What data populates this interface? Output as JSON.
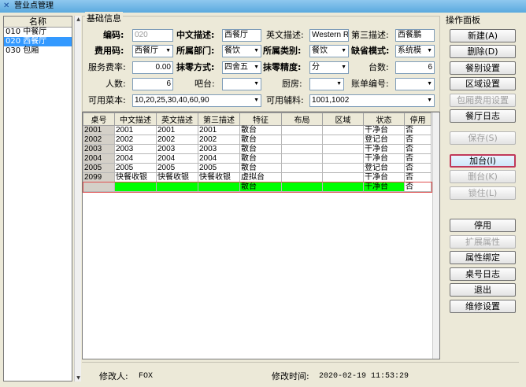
{
  "window": {
    "title": "营业点管理",
    "icon": "app-icon"
  },
  "left_list": {
    "header": "名称",
    "items": [
      "010 中餐厅",
      "020 西餐厅",
      "030 包厢"
    ],
    "selected_index": 1
  },
  "basic_info": {
    "title": "基础信息",
    "code_label": "编码:",
    "code_value": "020",
    "cn_desc_label": "中文描述:",
    "cn_desc_value": "西餐厅",
    "en_desc_label": "英文描述:",
    "en_desc_value": "Western R",
    "third_desc_label": "第三描述:",
    "third_desc_value": "西餐鵬",
    "fee_code_label": "费用码:",
    "fee_code_value": "西餐厅",
    "dept_label": "所属部门:",
    "dept_value": "餐饮",
    "category_label": "所属类别:",
    "category_value": "餐饮",
    "default_mode_label": "缺省模式:",
    "default_mode_value": "系统模",
    "service_rate_label": "服务费率:",
    "service_rate_value": "0.00",
    "rounding_mode_label": "抹零方式:",
    "rounding_mode_value": "四舍五",
    "rounding_precision_label": "抹零精度:",
    "rounding_precision_value": "分",
    "tables_label": "台数:",
    "tables_value": "6",
    "people_label": "人数:",
    "people_value": "6",
    "bar_label": "吧台:",
    "bar_value": "",
    "kitchen_label": "厨房:",
    "kitchen_value": "",
    "bill_no_label": "账单编号:",
    "bill_no_value": "",
    "menu_label": "可用菜本:",
    "menu_value": "10,20,25,30,40,60,90",
    "aux_label": "可用辅料:",
    "aux_value": "1001,1002"
  },
  "grid": {
    "columns": [
      "桌号",
      "中文描述",
      "英文描述",
      "第三描述",
      "特征",
      "布局",
      "区域",
      "状态",
      "停用"
    ],
    "rows": [
      [
        "2001",
        "2001",
        "2001",
        "2001",
        "散台",
        "",
        "",
        "干净台",
        "否"
      ],
      [
        "2002",
        "2002",
        "2002",
        "2002",
        "散台",
        "",
        "",
        "登记台",
        "否"
      ],
      [
        "2003",
        "2003",
        "2003",
        "2003",
        "散台",
        "",
        "",
        "干净台",
        "否"
      ],
      [
        "2004",
        "2004",
        "2004",
        "2004",
        "散台",
        "",
        "",
        "干净台",
        "否"
      ],
      [
        "2005",
        "2005",
        "2005",
        "2005",
        "散台",
        "",
        "",
        "登记台",
        "否"
      ],
      [
        "2099",
        "快餐收银",
        "快餐收银",
        "快餐收银",
        "虚拟台",
        "",
        "",
        "干净台",
        "否"
      ],
      [
        "",
        "",
        "",
        "",
        "散台",
        "",
        "",
        "干净台",
        "否"
      ]
    ]
  },
  "ops_panel": {
    "title": "操作面板",
    "buttons": [
      "新建(A)",
      "删除(D)",
      "餐别设置",
      "区域设置",
      "包厢费用设置",
      "餐厅日志",
      "保存(S)",
      "加台(I)",
      "删台(K)",
      "锁住(L)",
      "停用",
      "扩展属性",
      "属性绑定",
      "桌号日志",
      "退出",
      "维修设置"
    ]
  },
  "status_bar": {
    "modifier_label": "修改人:",
    "modifier_value": "FOX",
    "modified_time_label": "修改时间:",
    "modified_time_value": "2020-02-19 11:53:29"
  }
}
